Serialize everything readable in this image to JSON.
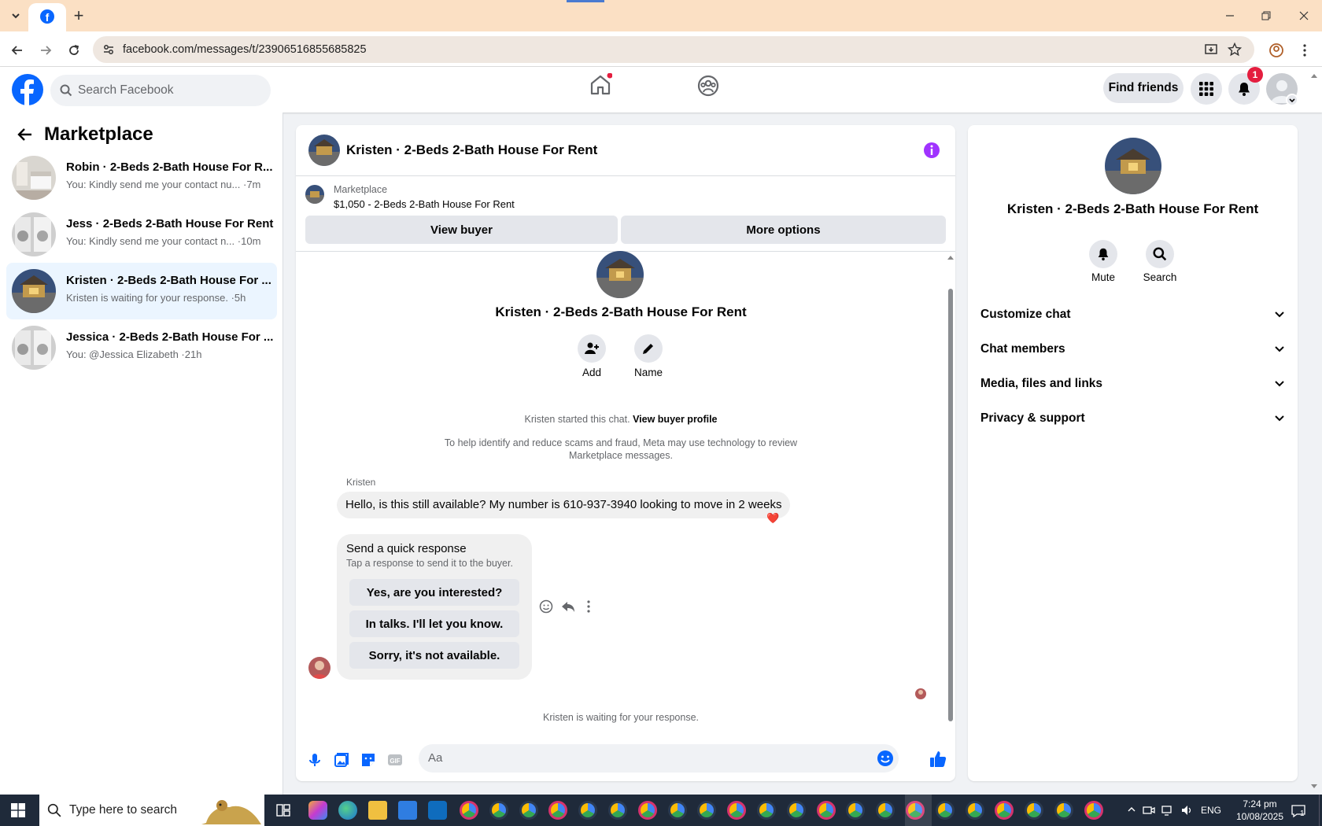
{
  "browser": {
    "url": "facebook.com/messages/t/23906516855685825",
    "new_tab_label": "+"
  },
  "fb_header": {
    "search_placeholder": "Search Facebook",
    "find_friends": "Find friends",
    "notification_count": "1"
  },
  "sidebar": {
    "title": "Marketplace",
    "conversations": [
      {
        "title": "Robin · 2-Beds 2-Bath House For R...",
        "preview": "You: Kindly send me your contact nu...",
        "time": "·7m",
        "selected": false
      },
      {
        "title": "Jess · 2-Beds 2-Bath House For Rent",
        "preview": "You: Kindly send me your contact n...",
        "time": "·10m",
        "selected": false
      },
      {
        "title": "Kristen · 2-Beds 2-Bath House For ...",
        "preview": "Kristen is waiting for your response.",
        "time": "·5h",
        "selected": true
      },
      {
        "title": "Jessica · 2-Beds 2-Bath House For ...",
        "preview": "You: @Jessica Elizabeth",
        "time": "·21h",
        "selected": false
      }
    ]
  },
  "chat": {
    "header_title": "Kristen · 2-Beds 2-Bath House For Rent",
    "listing_source": "Marketplace",
    "listing_title": "$1,050 - 2-Beds 2-Bath House For Rent",
    "view_buyer": "View buyer",
    "more_options": "More options",
    "profile_name": "Kristen · 2-Beds 2-Bath House For Rent",
    "add_label": "Add",
    "name_label": "Name",
    "started_text": "Kristen started this chat.",
    "view_buyer_profile": "View buyer profile",
    "disclaimer_line1": "To help identify and reduce scams and fraud, Meta may use technology to review",
    "disclaimer_line2": "Marketplace messages.",
    "sender_name": "Kristen",
    "message": "Hello, is this still available? My number is 610-937-3940 looking to move in 2 weeks",
    "reaction": "❤️",
    "quick_title": "Send a quick response",
    "quick_sub": "Tap a response to send it to the buyer.",
    "quick_responses": [
      "Yes, are you interested?",
      "In talks. I'll let you know.",
      "Sorry, it's not available."
    ],
    "waiting_text": "Kristen is waiting for your response.",
    "composer_placeholder": "Aa"
  },
  "details": {
    "name": "Kristen · 2-Beds 2-Bath House For Rent",
    "mute": "Mute",
    "search": "Search",
    "sections": [
      "Customize chat",
      "Chat members",
      "Media, files and links",
      "Privacy & support"
    ]
  },
  "taskbar": {
    "search_placeholder": "Type here to search",
    "lang": "ENG",
    "time": "7:24 pm",
    "date": "10/08/2025",
    "notif_count": "1"
  },
  "colors": {
    "fb_blue": "#0866ff",
    "purple_info": "#a033ff",
    "notif_red": "#e41e3f",
    "tab_bar": "#fbe0c4",
    "taskbar": "#1f2a3a"
  }
}
